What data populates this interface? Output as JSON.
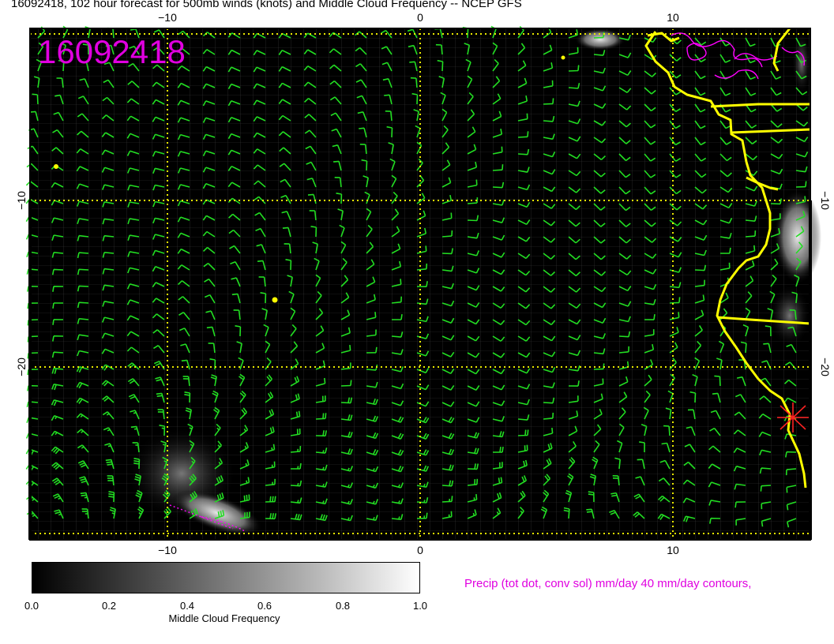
{
  "title": "16092418, 102 hour forecast for 500mb winds (knots) and Middle Cloud Frequency -- NCEP GFS",
  "map": {
    "date_stamp": "16092418",
    "lon_ticks": [
      "−10",
      "0",
      "10"
    ],
    "lat_ticks": [
      "−10",
      "−20"
    ],
    "colors": {
      "background": "#000000",
      "wind_barbs": "#22dd22",
      "coastline": "#ffff00",
      "grid_dotted": "#e8e800",
      "precip_contours": "#ff00ff",
      "station_marker": "#ff2222"
    }
  },
  "chart_data": {
    "type": "map",
    "lon_range": [
      -15.5,
      15.5
    ],
    "lat_range": [
      -28,
      1
    ],
    "dotted_grid_lon": [
      -10,
      0,
      10
    ],
    "dotted_grid_lat": [
      0,
      -10,
      -20
    ],
    "fields": [
      "500mb wind barbs (knots)",
      "Middle Cloud Frequency (shaded)",
      "Precip contours 40 mm/day"
    ]
  },
  "colorbar": {
    "labels": [
      "0.0",
      "0.2",
      "0.4",
      "0.6",
      "0.8",
      "1.0"
    ],
    "title": "Middle Cloud Frequency",
    "min": 0.0,
    "max": 1.0
  },
  "precip_note": "Precip (tot dot, conv sol) mm/day 40 mm/day contours,"
}
